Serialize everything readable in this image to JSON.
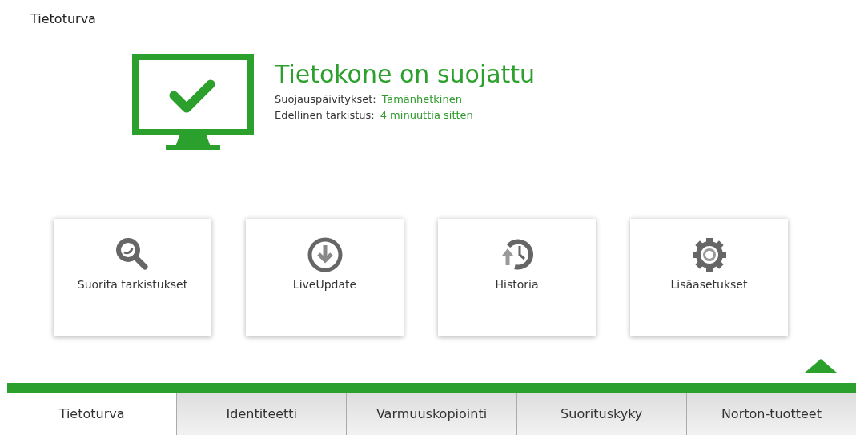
{
  "header": {
    "title": "Tietoturva"
  },
  "status": {
    "protected": true,
    "title": "Tietokone on suojattu",
    "details": [
      {
        "label": "Suojauspäivitykset:",
        "value": "Tämänhetkinen"
      },
      {
        "label": "Edellinen tarkistus:",
        "value": "4 minuuttia sitten"
      }
    ]
  },
  "actions": [
    {
      "kind": "scan",
      "label": "Suorita tarkistukset"
    },
    {
      "kind": "update",
      "label": "LiveUpdate"
    },
    {
      "kind": "history",
      "label": "Historia"
    },
    {
      "kind": "settings",
      "label": "Lisäasetukset"
    }
  ],
  "tabs": [
    {
      "label": "Tietoturva",
      "selected": true
    },
    {
      "label": "Identiteetti",
      "selected": false
    },
    {
      "label": "Varmuuskopiointi",
      "selected": false
    },
    {
      "label": "Suorituskyky",
      "selected": false
    },
    {
      "label": "Norton-tuotteet",
      "selected": false
    }
  ]
}
